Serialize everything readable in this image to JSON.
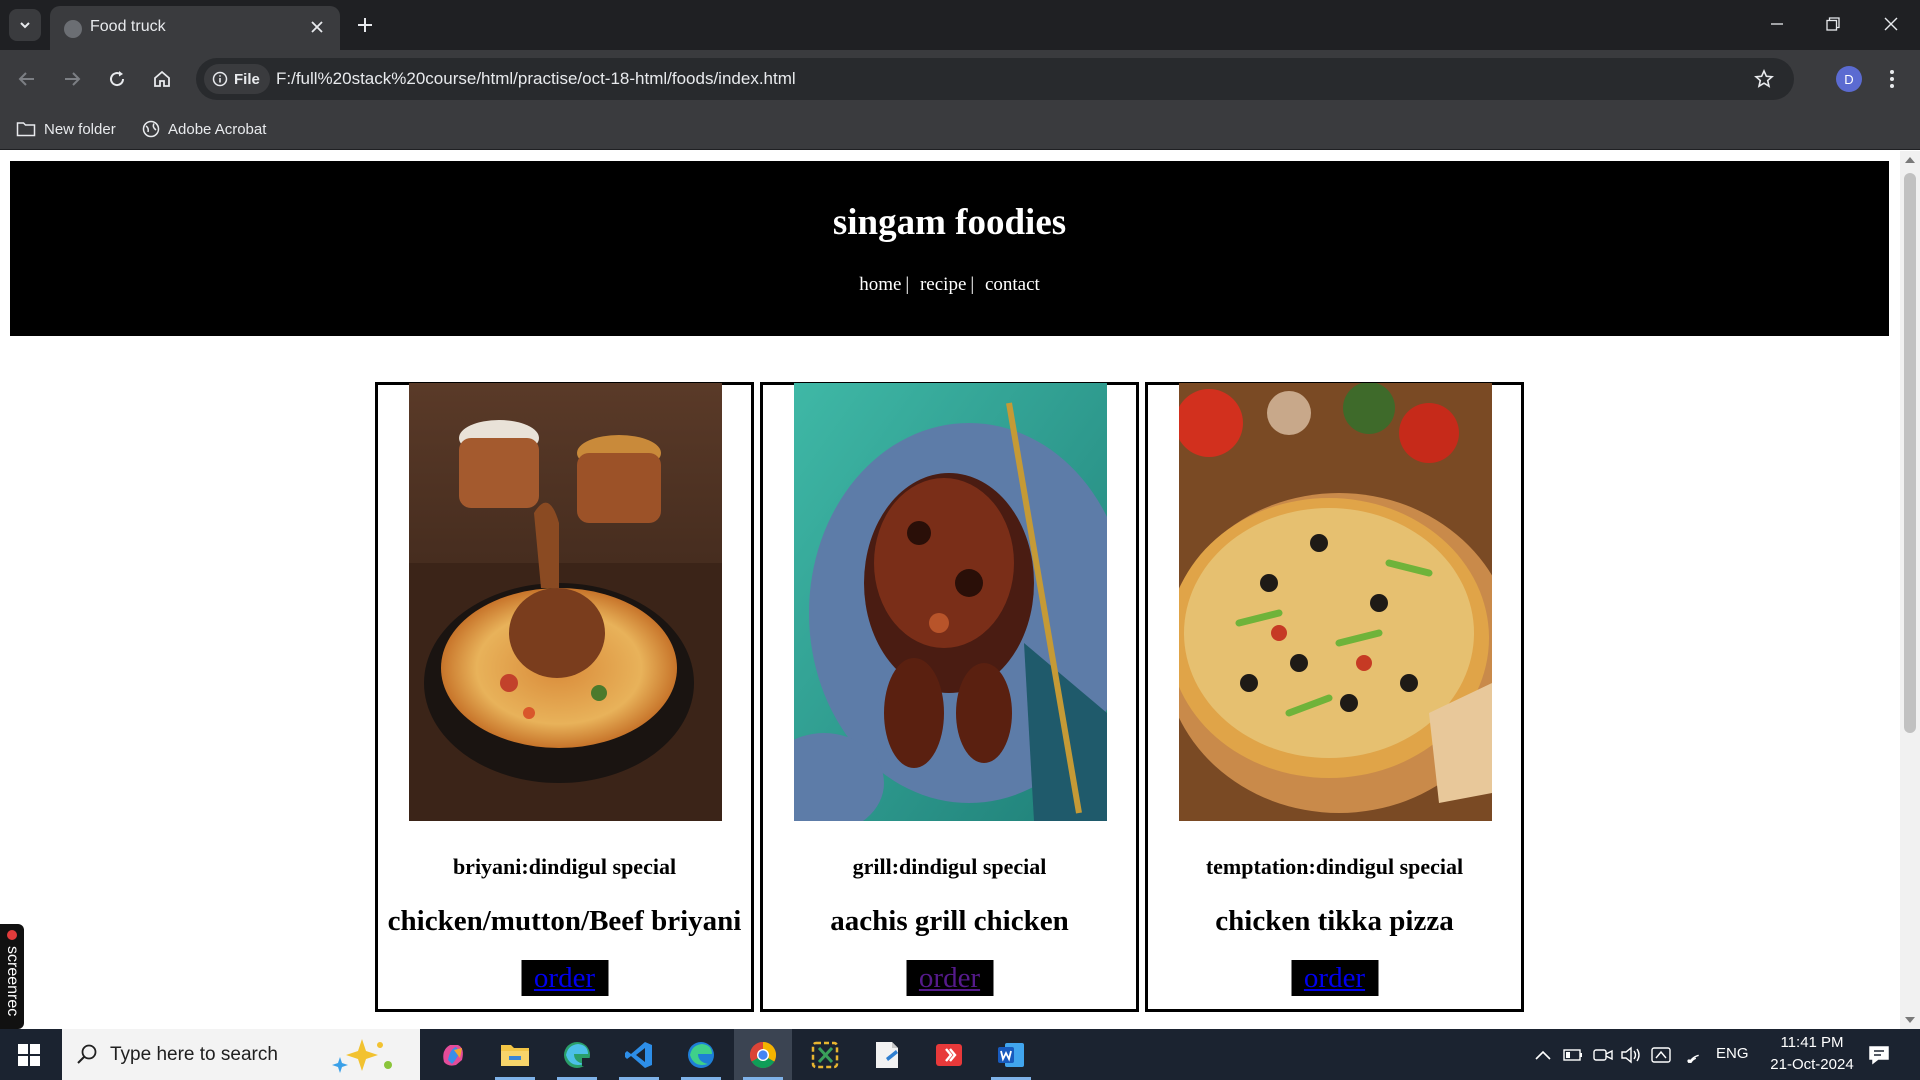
{
  "browser": {
    "tab_title": "Food truck",
    "site_chip": "File",
    "url": "F:/full%20stack%20course/html/practise/oct-18-html/foods/index.html",
    "profile_initial": "D",
    "bookmarks": [
      "New folder",
      "Adobe Acrobat"
    ]
  },
  "page": {
    "title": "singam foodies",
    "nav": [
      "home",
      "recipe",
      "contact"
    ],
    "nav_separator": "|",
    "cards": [
      {
        "subtitle": "briyani:dindigul special",
        "name": "chicken/mutton/Beef briyani",
        "action": "order",
        "link_color": "#0000ee"
      },
      {
        "subtitle": "grill:dindigul special",
        "name": "aachis grill chicken",
        "action": "order",
        "link_color": "#551a8b"
      },
      {
        "subtitle": "temptation:dindigul special",
        "name": "chicken tikka pizza",
        "action": "order",
        "link_color": "#0000ee"
      }
    ]
  },
  "overlay": {
    "recorder_label": "screenrec"
  },
  "taskbar": {
    "search_placeholder": "Type here to search",
    "language": "ENG",
    "time": "11:41 PM",
    "date": "21-Oct-2024"
  }
}
